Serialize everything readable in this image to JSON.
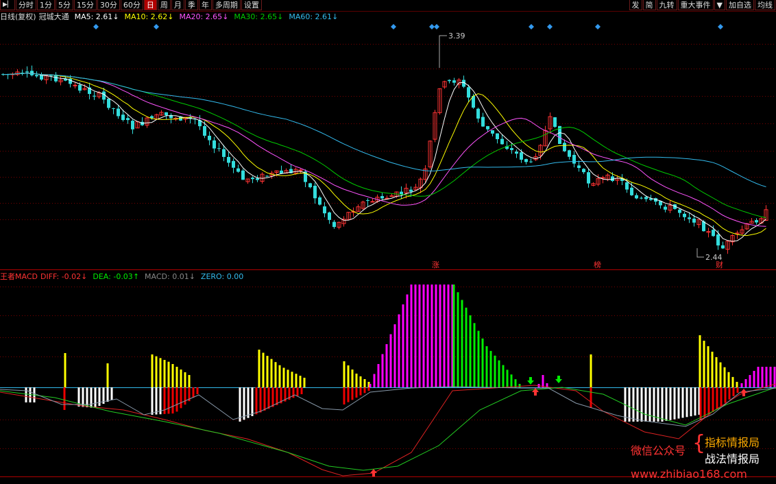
{
  "toolbar": {
    "left_tabs": [
      {
        "label": "分时",
        "active": false
      },
      {
        "label": "1分",
        "active": false
      },
      {
        "label": "5分",
        "active": false
      },
      {
        "label": "15分",
        "active": false
      },
      {
        "label": "30分",
        "active": false
      },
      {
        "label": "60分",
        "active": false
      },
      {
        "label": "日",
        "active": true
      },
      {
        "label": "周",
        "active": false
      },
      {
        "label": "月",
        "active": false
      },
      {
        "label": "季",
        "active": false
      },
      {
        "label": "年",
        "active": false
      },
      {
        "label": "多周期",
        "active": false
      },
      {
        "label": "设置",
        "active": false
      }
    ],
    "right_buttons": [
      "发",
      "简",
      "九转",
      "重大事件",
      "▼",
      "加自选",
      "均线"
    ]
  },
  "kline_legend": {
    "prefix": "日线(复权)",
    "indicator": "冠城大通",
    "items": [
      {
        "label": "MA5: 2.61",
        "trend": "↓",
        "color": "#ffffff"
      },
      {
        "label": "MA10: 2.62",
        "trend": "↓",
        "color": "#ffff00"
      },
      {
        "label": "MA20: 2.65",
        "trend": "↓",
        "color": "#ff55ff"
      },
      {
        "label": "MA30: 2.65",
        "trend": "↓",
        "color": "#00cc00"
      },
      {
        "label": "MA60: 2.61",
        "trend": "↓",
        "color": "#33bbee"
      }
    ]
  },
  "macd_legend": {
    "prefix": "王者MACD",
    "items": [
      {
        "label": "DIFF: -0.02",
        "trend": "↓",
        "color": "#ff3333"
      },
      {
        "label": "DEA: -0.03",
        "trend": "↑",
        "color": "#00ee00"
      },
      {
        "label": "MACD: 0.01",
        "trend": "↓",
        "color": "#888888"
      },
      {
        "label": "ZERO: 0.00",
        "trend": "",
        "color": "#33bbee"
      }
    ]
  },
  "price_annotations": {
    "high": "3.39",
    "low": "2.44"
  },
  "event_markers": [
    "涨",
    "榜",
    "财"
  ],
  "watermark": {
    "wechat": "微信公众号",
    "line1": "指标情报局",
    "line2": "战法情报局",
    "url": "www.zhibiao168.com"
  },
  "colors": {
    "up": "#ff3333",
    "down": "#33dddd",
    "ma5": "#ffffff",
    "ma10": "#ffff00",
    "ma20": "#ff55ff",
    "ma30": "#00cc00",
    "ma60": "#33bbee",
    "grid": "#7a0000",
    "macd_up_strong": "#ff00ff",
    "macd_up_weak": "#ffff00",
    "macd_down_strong": "#ee0000",
    "macd_down_weak": "#ffffff",
    "macd_green": "#00ee00"
  }
}
